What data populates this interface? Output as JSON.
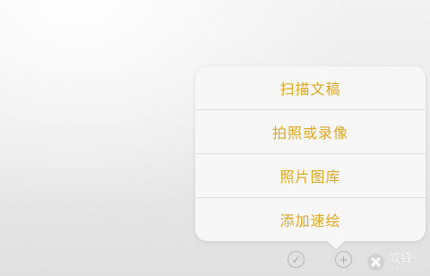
{
  "menu": {
    "items": [
      {
        "label": "扫描文稿"
      },
      {
        "label": "拍照或录像"
      },
      {
        "label": "照片图库"
      },
      {
        "label": "添加速绘"
      }
    ]
  },
  "toolbar": {
    "checklist_icon": "✓",
    "add_icon": "+"
  },
  "watermark": {
    "text": "威锋",
    "subtext": "FENG.COM"
  },
  "colors": {
    "accent": "#e0a720",
    "popover": "#f7f7f7",
    "background": "#eeeeee"
  }
}
